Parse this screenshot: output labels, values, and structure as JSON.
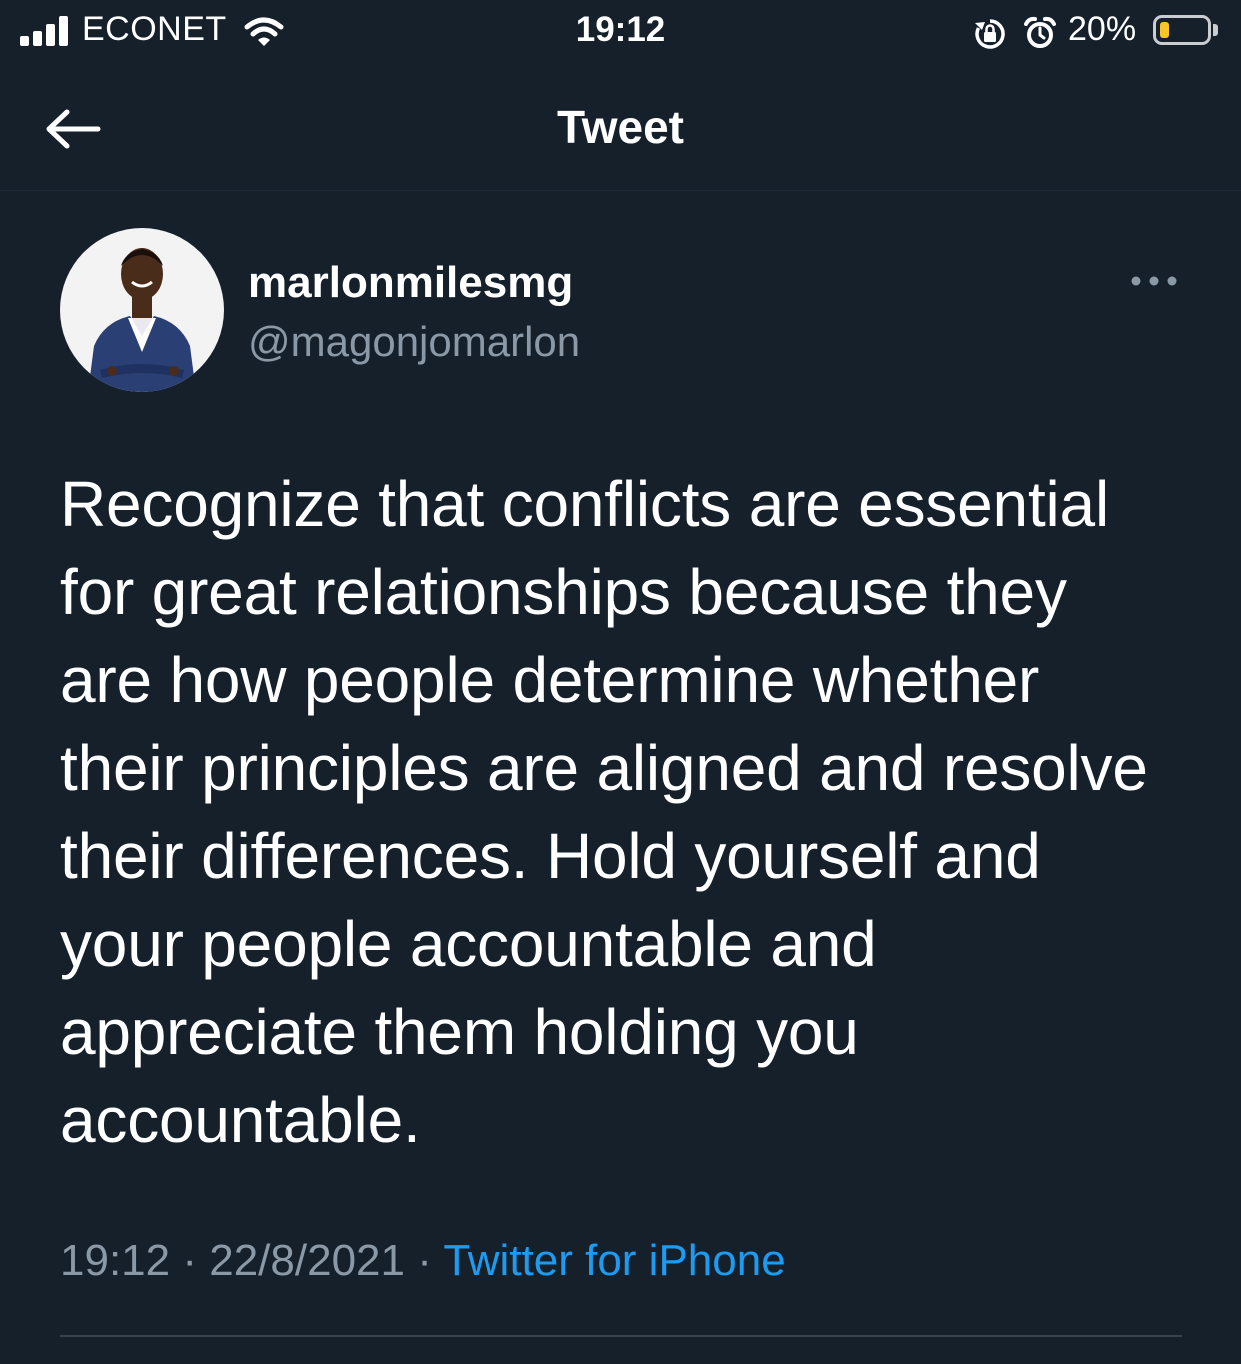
{
  "status_bar": {
    "carrier": "ECONET",
    "time": "19:12",
    "battery_percent": "20%",
    "battery_level": 0.2,
    "signal_bars": 4,
    "battery_color": "#f7c52b"
  },
  "header": {
    "title": "Tweet",
    "back_icon": "arrow-left-icon"
  },
  "tweet": {
    "author": {
      "display_name": "marlonmilesmg",
      "handle": "@magonjomarlon"
    },
    "more_icon": "more-horizontal-icon",
    "text": "Recognize that conflicts are essential\nfor great relationships because they\nare how people determine whether\ntheir principles are aligned and resolve\ntheir differences. Hold yourself and\nyour people accountable and\nappreciate them holding you\naccountable.",
    "meta": {
      "time": "19:12",
      "separator": "·",
      "date": "22/8/2021",
      "source": "Twitter for iPhone"
    }
  },
  "colors": {
    "background": "#15202b",
    "secondary_text": "#8b98a5",
    "link": "#1d9bf0",
    "divider": "#38444d"
  }
}
